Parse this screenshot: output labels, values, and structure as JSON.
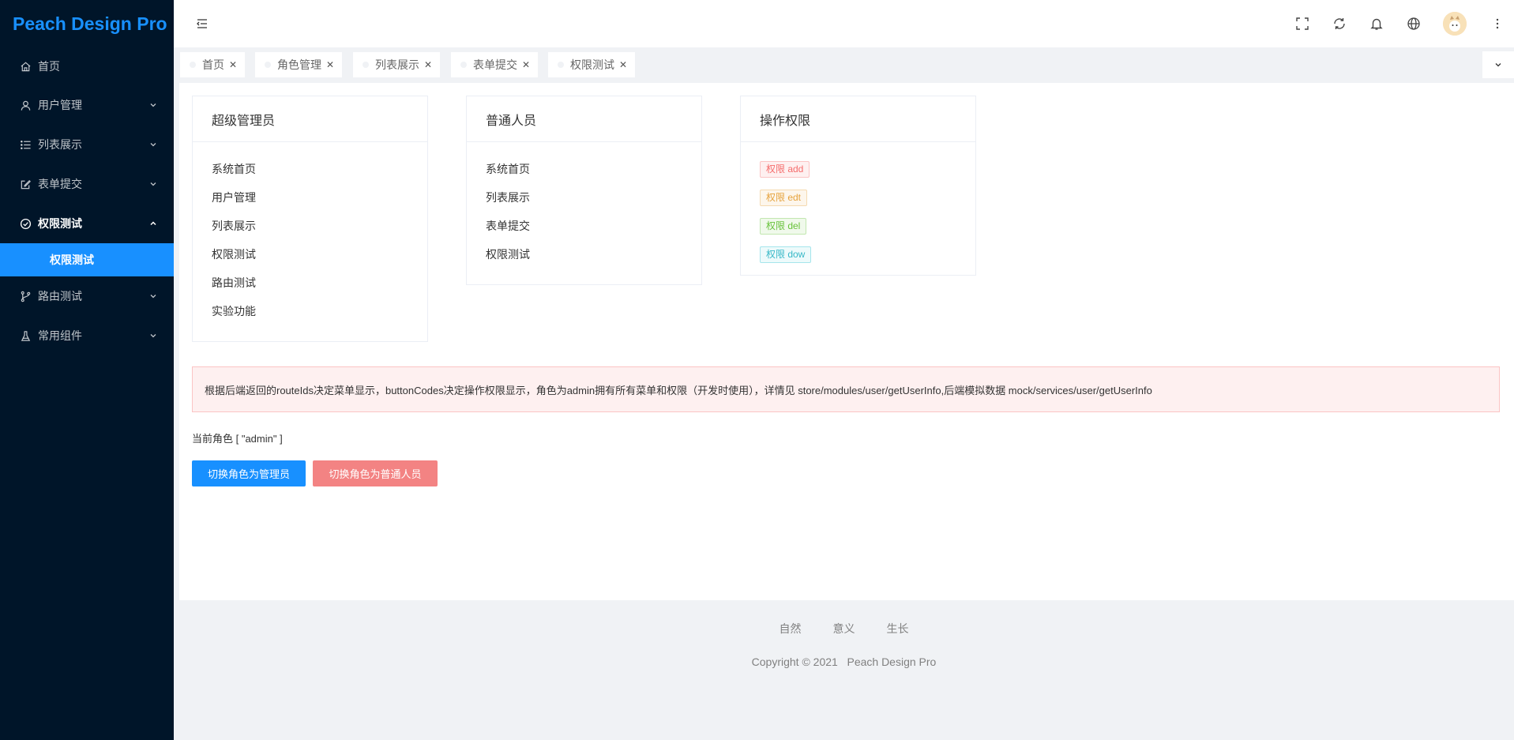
{
  "app": {
    "logo": "Peach Design Pro"
  },
  "sidebar": {
    "items": [
      {
        "label": "首页",
        "icon": "home-icon"
      },
      {
        "label": "用户管理",
        "icon": "user-icon"
      },
      {
        "label": "列表展示",
        "icon": "list-icon"
      },
      {
        "label": "表单提交",
        "icon": "edit-icon"
      },
      {
        "label": "权限测试",
        "icon": "check-circle-icon"
      },
      {
        "label": "路由测试",
        "icon": "branch-icon"
      },
      {
        "label": "常用组件",
        "icon": "flask-icon"
      }
    ],
    "active_sub": "权限测试"
  },
  "tabs": [
    {
      "label": "首页"
    },
    {
      "label": "角色管理"
    },
    {
      "label": "列表展示"
    },
    {
      "label": "表单提交"
    },
    {
      "label": "权限测试"
    }
  ],
  "cards": {
    "super_admin": {
      "title": "超级管理员",
      "items": [
        "系统首页",
        "用户管理",
        "列表展示",
        "权限测试",
        "路由测试",
        "实验功能"
      ]
    },
    "normal_user": {
      "title": "普通人员",
      "items": [
        "系统首页",
        "列表展示",
        "表单提交",
        "权限测试"
      ]
    },
    "permissions": {
      "title": "操作权限",
      "tags": [
        {
          "label": "权限 add",
          "color": "#f56c6c",
          "bg": "#fef0f0",
          "border": "#fbc4c4"
        },
        {
          "label": "权限 edt",
          "color": "#e6a23c",
          "bg": "#fdf6ec",
          "border": "#f5dab1"
        },
        {
          "label": "权限 del",
          "color": "#67c23a",
          "bg": "#f0f9eb",
          "border": "#c2e7b0"
        },
        {
          "label": "权限 dow",
          "color": "#37b8c7",
          "bg": "#edfafb",
          "border": "#a5e5ec"
        }
      ]
    }
  },
  "alert": {
    "text": "根据后端返回的routeIds决定菜单显示，buttonCodes决定操作权限显示，角色为admin拥有所有菜单和权限（开发时使用），详情见 store/modules/user/getUserInfo,后端模拟数据 mock/services/user/getUserInfo"
  },
  "current_role": "当前角色 [ \"admin\" ]",
  "buttons": {
    "switch_admin": "切换角色为管理员",
    "switch_normal": "切换角色为普通人员"
  },
  "footer": {
    "links": [
      "自然",
      "意义",
      "生长"
    ],
    "copyright": "Copyright © 2021   Peach Design Pro"
  },
  "colors": {
    "sidebar_bg": "#001529",
    "primary": "#1890ff",
    "danger_btn": "#f38383"
  }
}
